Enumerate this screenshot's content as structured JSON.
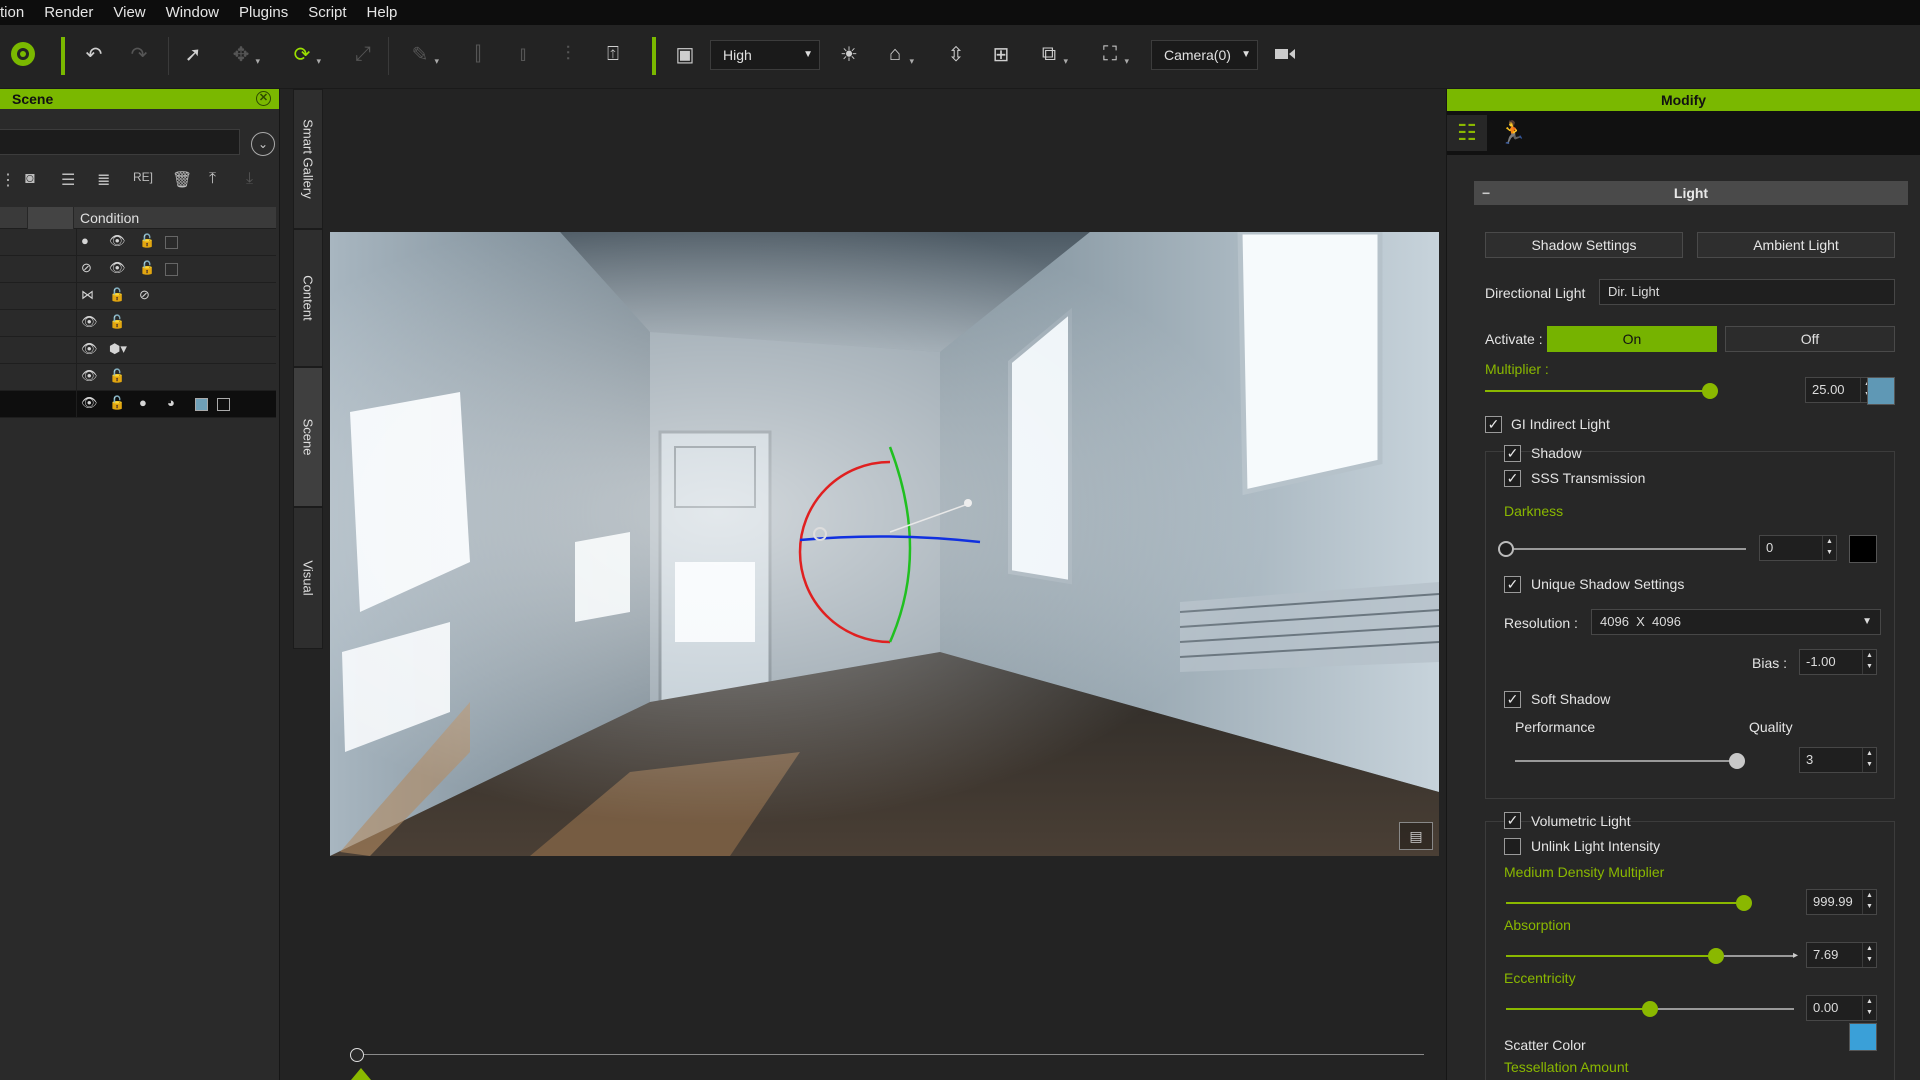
{
  "menu": [
    "tion",
    "Render",
    "View",
    "Window",
    "Plugins",
    "Script",
    "Help"
  ],
  "toolbar": {
    "quality": "High",
    "camera": "Camera(0)"
  },
  "scene": {
    "title": "Scene",
    "column_header": "Condition"
  },
  "side_tabs": [
    "Smart Gallery",
    "Content",
    "Scene",
    "Visual"
  ],
  "modify": {
    "title": "Modify",
    "section_title": "Light",
    "shadow_settings": "Shadow Settings",
    "ambient_light": "Ambient Light",
    "directional_label": "Directional Light",
    "directional_value": "Dir. Light",
    "activate_label": "Activate :",
    "on": "On",
    "off": "Off",
    "multiplier_label": "Multiplier :",
    "multiplier_value": "25.00",
    "multiplier_level": 0.98,
    "light_color": "#5f98b5",
    "gi_indirect": "GI Indirect Light",
    "shadow": "Shadow",
    "sss": "SSS Transmission",
    "darkness_label": "Darkness",
    "darkness_value": "0",
    "darkness_level": 0.0,
    "darkness_color": "#000000",
    "unique_shadow": "Unique Shadow Settings",
    "resolution_label": "Resolution :",
    "resolution_value": "4096  X  4096",
    "bias_label": "Bias :",
    "bias_value": "-1.00",
    "soft_shadow": "Soft Shadow",
    "performance": "Performance",
    "quality": "Quality",
    "soft_value": "3",
    "soft_level": 1.0,
    "volumetric": "Volumetric Light",
    "unlink": "Unlink Light Intensity",
    "density_label": "Medium Density Multiplier",
    "density_value": "999.99",
    "density_level": 1.0,
    "absorption_label": "Absorption",
    "absorption_value": "7.69",
    "absorption_level": 0.73,
    "eccentricity_label": "Eccentricity",
    "eccentricity_value": "0.00",
    "eccentricity_level": 0.5,
    "scatter_label": "Scatter Color",
    "scatter_color": "#3aa0d8",
    "tessellation_label": "Tessellation Amount"
  },
  "colors": {
    "accent": "#7ab800"
  }
}
